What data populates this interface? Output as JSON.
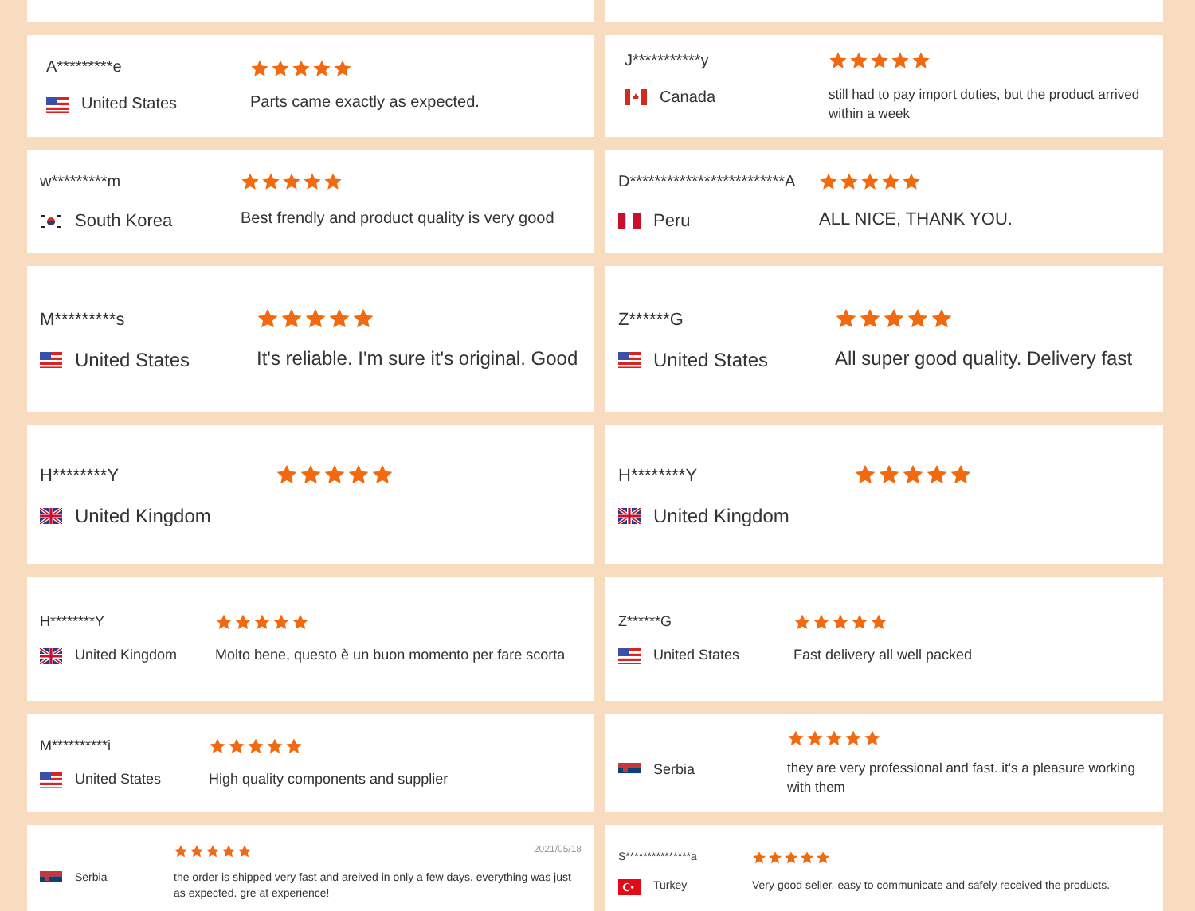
{
  "rows": [
    {
      "left": {
        "kind": "blank"
      },
      "right": {
        "kind": "blank"
      }
    },
    {
      "left": {
        "kind": "review",
        "name": "A*********e",
        "flag": {
          "kind": "us"
        },
        "country": "United States",
        "stars": 5,
        "comment": "Parts came exactly as expected."
      },
      "right": {
        "kind": "review",
        "name": "J***********y",
        "flag": {
          "kind": "ca"
        },
        "country": "Canada",
        "stars": 5,
        "comment": "still had to pay import duties, but the product arrived within a week"
      }
    },
    {
      "left": {
        "kind": "review",
        "name": "w*********m",
        "flag": {
          "kind": "kr"
        },
        "country": "South Korea",
        "stars": 5,
        "comment": "Best frendly and product quality is very good"
      },
      "right": {
        "kind": "review",
        "name": "D*************************A",
        "flag": {
          "kind": "pe"
        },
        "country": "Peru",
        "stars": 5,
        "comment": "ALL NICE, THANK YOU."
      }
    },
    {
      "left": {
        "kind": "review",
        "name": "M*********s",
        "flag": {
          "kind": "us"
        },
        "country": "United States",
        "stars": 5,
        "comment": "It's reliable. I'm sure it's original. Good"
      },
      "right": {
        "kind": "review",
        "name": "Z******G",
        "flag": {
          "kind": "us"
        },
        "country": "United States",
        "stars": 5,
        "comment": "All super good quality. Delivery fast"
      }
    },
    {
      "left": {
        "kind": "review",
        "name": "H********Y",
        "flag": {
          "kind": "gb"
        },
        "country": "United Kingdom",
        "stars": 5
      },
      "right": {
        "kind": "review",
        "name": "H********Y",
        "flag": {
          "kind": "gb"
        },
        "country": "United Kingdom",
        "stars": 5
      }
    },
    {
      "left": {
        "kind": "review",
        "name": "H********Y",
        "flag": {
          "kind": "gb"
        },
        "country": "United Kingdom",
        "stars": 5,
        "comment": "Molto bene, questo è un buon momento per fare scorta"
      },
      "right": {
        "kind": "review",
        "name": "Z******G",
        "flag": {
          "kind": "us"
        },
        "country": "United States",
        "stars": 5,
        "comment": "Fast delivery all well packed"
      }
    },
    {
      "left": {
        "kind": "review",
        "name": "M**********i",
        "flag": {
          "kind": "us"
        },
        "country": "United States",
        "stars": 5,
        "comment": "High quality components and supplier"
      },
      "right": {
        "kind": "review",
        "flag": {
          "kind": "rs"
        },
        "country": "Serbia",
        "stars": 5,
        "comment": "they are very professional and fast. it's a pleasure working with them"
      }
    },
    {
      "left": {
        "kind": "review",
        "flag": {
          "kind": "rs"
        },
        "country": "Serbia",
        "stars": 5,
        "date": "2021/05/18",
        "comment": "the order is shipped very fast and areived in only a few days. everything was just as expected. gre at experience!"
      },
      "right": {
        "kind": "review",
        "name": "S***************a",
        "flag": {
          "kind": "tr"
        },
        "country": "Turkey",
        "stars": 5,
        "comment": "Very good seller, easy to communicate and safely received the products."
      }
    }
  ]
}
